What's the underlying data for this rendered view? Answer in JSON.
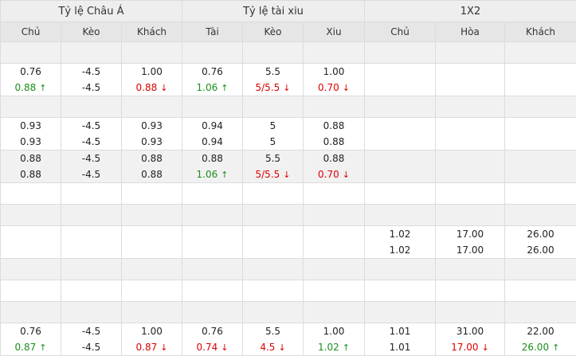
{
  "groups": [
    {
      "label": "Tỷ lệ Châu Á"
    },
    {
      "label": "Tỷ lệ tài xiu"
    },
    {
      "label": "1X2"
    }
  ],
  "columns": [
    "Chủ",
    "Kèo",
    "Khách",
    "Tài",
    "Kèo",
    "Xiu",
    "Chủ",
    "Hòa",
    "Khách"
  ],
  "rows": [
    {
      "bg": "g",
      "kind": "empty"
    },
    {
      "bg": "w",
      "kind": "data",
      "h": 42,
      "cells": [
        [
          {
            "v": "0.76",
            "c": ""
          },
          {
            "v": "0.88",
            "c": "up"
          }
        ],
        [
          {
            "v": "-4.5",
            "c": ""
          },
          {
            "v": "-4.5",
            "c": ""
          }
        ],
        [
          {
            "v": "1.00",
            "c": ""
          },
          {
            "v": "0.88",
            "c": "down"
          }
        ],
        [
          {
            "v": "0.76",
            "c": ""
          },
          {
            "v": "1.06",
            "c": "up"
          }
        ],
        [
          {
            "v": "5.5",
            "c": ""
          },
          {
            "v": "5/5.5",
            "c": "down"
          }
        ],
        [
          {
            "v": "1.00",
            "c": ""
          },
          {
            "v": "0.70",
            "c": "down"
          }
        ],
        [],
        [],
        []
      ]
    },
    {
      "bg": "g",
      "kind": "empty"
    },
    {
      "bg": "w",
      "kind": "data",
      "h": 42,
      "cells": [
        [
          {
            "v": "0.93",
            "c": ""
          },
          {
            "v": "0.93",
            "c": ""
          }
        ],
        [
          {
            "v": "-4.5",
            "c": ""
          },
          {
            "v": "-4.5",
            "c": ""
          }
        ],
        [
          {
            "v": "0.93",
            "c": ""
          },
          {
            "v": "0.93",
            "c": ""
          }
        ],
        [
          {
            "v": "0.94",
            "c": ""
          },
          {
            "v": "0.94",
            "c": ""
          }
        ],
        [
          {
            "v": "5",
            "c": ""
          },
          {
            "v": "5",
            "c": ""
          }
        ],
        [
          {
            "v": "0.88",
            "c": ""
          },
          {
            "v": "0.88",
            "c": ""
          }
        ],
        [],
        [],
        []
      ]
    },
    {
      "bg": "g",
      "kind": "data",
      "h": 42,
      "cells": [
        [
          {
            "v": "0.88",
            "c": ""
          },
          {
            "v": "0.88",
            "c": ""
          }
        ],
        [
          {
            "v": "-4.5",
            "c": ""
          },
          {
            "v": "-4.5",
            "c": ""
          }
        ],
        [
          {
            "v": "0.88",
            "c": ""
          },
          {
            "v": "0.88",
            "c": ""
          }
        ],
        [
          {
            "v": "0.88",
            "c": ""
          },
          {
            "v": "1.06",
            "c": "up"
          }
        ],
        [
          {
            "v": "5.5",
            "c": ""
          },
          {
            "v": "5/5.5",
            "c": "down"
          }
        ],
        [
          {
            "v": "0.88",
            "c": ""
          },
          {
            "v": "0.70",
            "c": "down"
          }
        ],
        [],
        [],
        []
      ]
    },
    {
      "bg": "w",
      "kind": "empty"
    },
    {
      "bg": "g",
      "kind": "empty"
    },
    {
      "bg": "w",
      "kind": "data",
      "h": 42,
      "cells": [
        [],
        [],
        [],
        [],
        [],
        [],
        [
          {
            "v": "1.02",
            "c": ""
          },
          {
            "v": "1.02",
            "c": ""
          }
        ],
        [
          {
            "v": "17.00",
            "c": ""
          },
          {
            "v": "17.00",
            "c": ""
          }
        ],
        [
          {
            "v": "26.00",
            "c": ""
          },
          {
            "v": "26.00",
            "c": ""
          }
        ]
      ]
    },
    {
      "bg": "g",
      "kind": "empty"
    },
    {
      "bg": "w",
      "kind": "empty"
    },
    {
      "bg": "g",
      "kind": "empty"
    },
    {
      "bg": "w",
      "kind": "data",
      "h": 42,
      "cells": [
        [
          {
            "v": "0.76",
            "c": ""
          },
          {
            "v": "0.87",
            "c": "up"
          }
        ],
        [
          {
            "v": "-4.5",
            "c": ""
          },
          {
            "v": "-4.5",
            "c": ""
          }
        ],
        [
          {
            "v": "1.00",
            "c": ""
          },
          {
            "v": "0.87",
            "c": "down"
          }
        ],
        [
          {
            "v": "0.76",
            "c": ""
          },
          {
            "v": "0.74",
            "c": "down"
          }
        ],
        [
          {
            "v": "5.5",
            "c": ""
          },
          {
            "v": "4.5",
            "c": "down"
          }
        ],
        [
          {
            "v": "1.00",
            "c": ""
          },
          {
            "v": "1.02",
            "c": "up"
          }
        ],
        [
          {
            "v": "1.01",
            "c": ""
          },
          {
            "v": "1.01",
            "c": ""
          }
        ],
        [
          {
            "v": "31.00",
            "c": ""
          },
          {
            "v": "17.00",
            "c": "down"
          }
        ],
        [
          {
            "v": "22.00",
            "c": ""
          },
          {
            "v": "26.00",
            "c": "up"
          }
        ]
      ]
    }
  ],
  "colors": {
    "up": "#1a8f1a",
    "down": "#e00000"
  }
}
